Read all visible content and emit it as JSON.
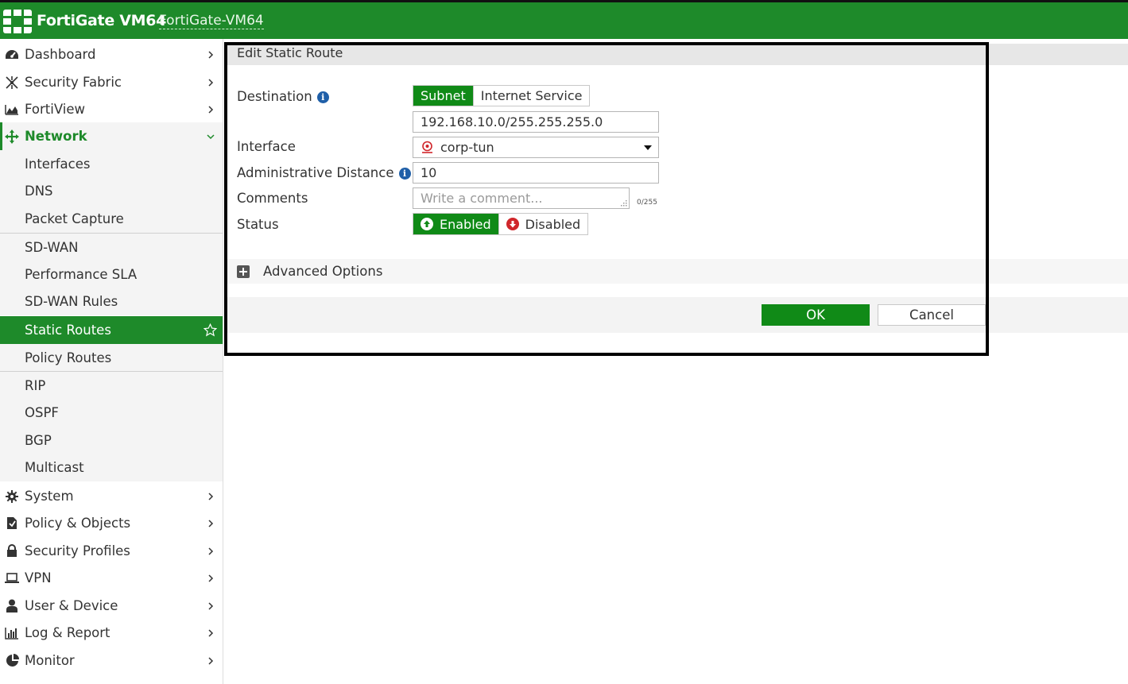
{
  "header": {
    "brand": "FortiGate VM64",
    "hostname": "FortiGate-VM64",
    "bar_color": "#1e8a2a"
  },
  "sidebar": {
    "items": [
      {
        "label": "Dashboard",
        "icon": "dashboard-icon"
      },
      {
        "label": "Security Fabric",
        "icon": "security-fabric-icon"
      },
      {
        "label": "FortiView",
        "icon": "fortiview-icon"
      },
      {
        "label": "Network",
        "icon": "network-icon",
        "expanded": true
      },
      {
        "label": "Interfaces"
      },
      {
        "label": "DNS"
      },
      {
        "label": "Packet Capture"
      },
      {
        "label": "SD-WAN"
      },
      {
        "label": "Performance SLA"
      },
      {
        "label": "SD-WAN Rules"
      },
      {
        "label": "Static Routes",
        "active": true
      },
      {
        "label": "Policy Routes"
      },
      {
        "label": "RIP"
      },
      {
        "label": "OSPF"
      },
      {
        "label": "BGP"
      },
      {
        "label": "Multicast"
      },
      {
        "label": "System",
        "icon": "gear-icon"
      },
      {
        "label": "Policy & Objects",
        "icon": "policy-objects-icon"
      },
      {
        "label": "Security Profiles",
        "icon": "lock-icon"
      },
      {
        "label": "VPN",
        "icon": "laptop-icon"
      },
      {
        "label": "User & Device",
        "icon": "user-icon"
      },
      {
        "label": "Log & Report",
        "icon": "bar-chart-icon"
      },
      {
        "label": "Monitor",
        "icon": "pie-chart-icon"
      }
    ]
  },
  "dialog": {
    "title": "Edit Static Route",
    "destination": {
      "label": "Destination",
      "options": [
        "Subnet",
        "Internet Service"
      ],
      "selected": "Subnet",
      "value": "192.168.10.0/255.255.255.0"
    },
    "interface": {
      "label": "Interface",
      "value": "corp-tun"
    },
    "admin_distance": {
      "label": "Administrative Distance",
      "value": "10"
    },
    "comments": {
      "label": "Comments",
      "placeholder": "Write a comment...",
      "counter": "0/255"
    },
    "status": {
      "label": "Status",
      "enabled_label": "Enabled",
      "disabled_label": "Disabled",
      "selected": "Enabled"
    },
    "advanced_label": "Advanced Options",
    "ok_label": "OK",
    "cancel_label": "Cancel"
  },
  "colors": {
    "accent": "#108a17",
    "info": "#1f5fa8",
    "disabled_red": "#d0262b"
  }
}
